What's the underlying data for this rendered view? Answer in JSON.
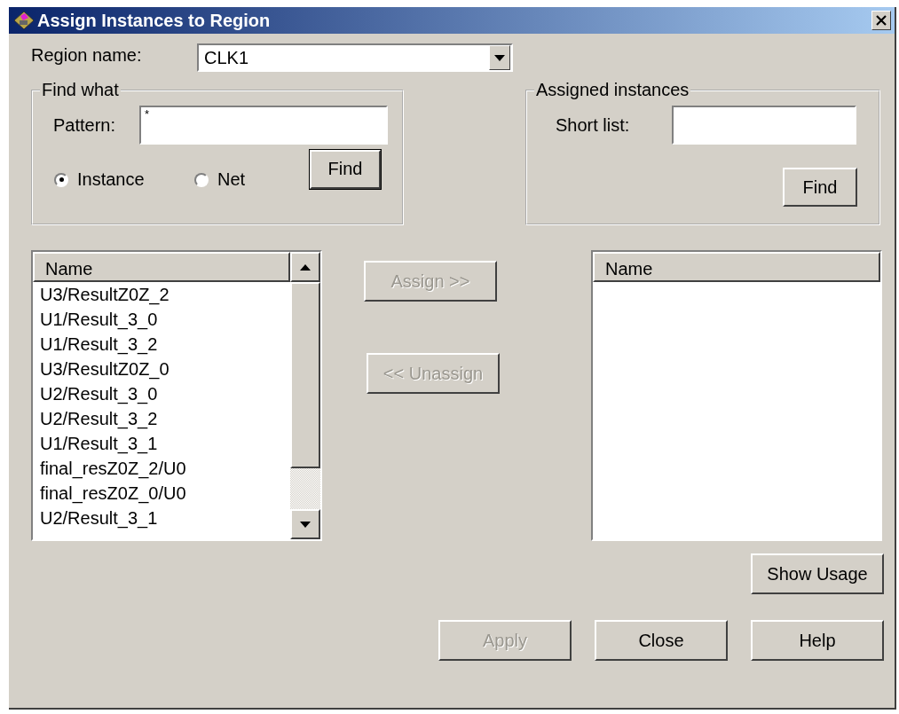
{
  "window": {
    "title": "Assign Instances to Region"
  },
  "region_name": {
    "label": "Region name:",
    "value": "CLK1"
  },
  "find_what": {
    "title": "Find what",
    "pattern_label": "Pattern:",
    "pattern_value": "*",
    "options": [
      {
        "label": "Instance",
        "selected": true
      },
      {
        "label": "Net",
        "selected": false
      }
    ],
    "find_button": "Find"
  },
  "assigned_instances": {
    "title": "Assigned instances",
    "short_list_label": "Short list:",
    "find_button": "Find"
  },
  "available_list": {
    "column": "Name",
    "rows": [
      "U3/ResultZ0Z_2",
      "U1/Result_3_0",
      "U1/Result_3_2",
      "U3/ResultZ0Z_0",
      "U2/Result_3_0",
      "U2/Result_3_2",
      "U1/Result_3_1",
      "final_resZ0Z_2/U0",
      "final_resZ0Z_0/U0",
      "U2/Result_3_1"
    ]
  },
  "assign_button": {
    "label": "Assign >>",
    "disabled": true
  },
  "unassign_button": {
    "label": "<< Unassign",
    "disabled": true
  },
  "assigned_list": {
    "column": "Name"
  },
  "show_usage_button": {
    "label": "Show Usage",
    "disabled": false
  },
  "buttons": [
    {
      "label": "Apply",
      "disabled": true
    },
    {
      "label": "Close",
      "disabled": false
    },
    {
      "label": "Help",
      "disabled": false
    }
  ]
}
